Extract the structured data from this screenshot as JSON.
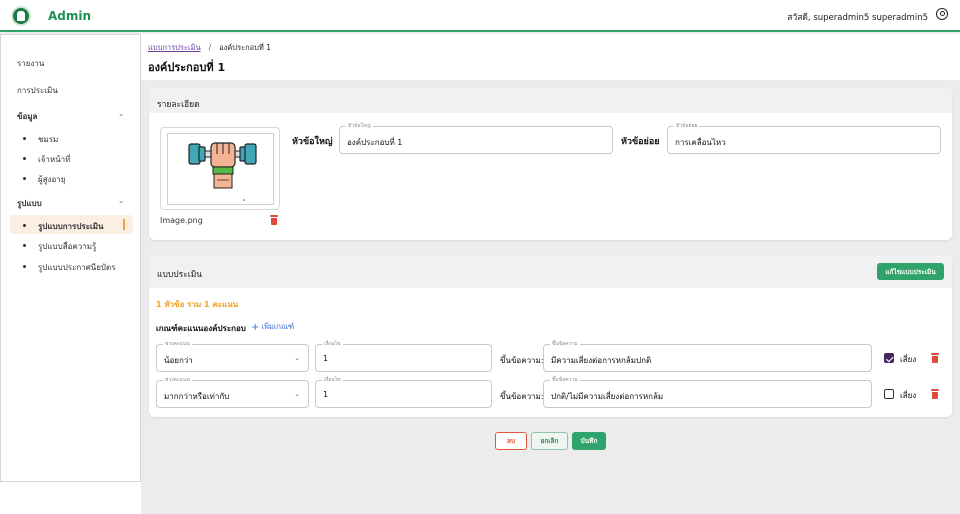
{
  "header": {
    "brand": "Admin",
    "greeting": "สวัสดี, superadmin5 superadmin5"
  },
  "sidebar": {
    "items": [
      {
        "label": "รายงาน"
      },
      {
        "label": "การประเมิน"
      }
    ],
    "sections": [
      {
        "label": "ข้อมูล",
        "children": [
          "ชมรม",
          "เจ้าหน้าที่",
          "ผู้สูงอายุ"
        ]
      },
      {
        "label": "รูปแบบ",
        "children": [
          "รูปแบบการประเมิน",
          "รูปแบบสื่อความรู้",
          "รูปแบบประกาศนียบัตร"
        ]
      }
    ],
    "active": "รูปแบบการประเมิน"
  },
  "breadcrumb": {
    "parent": "แบบการประเมิน",
    "current": "องค์ประกอบที่ 1"
  },
  "page_title": "องค์ประกอบที่ 1",
  "details": {
    "header": "รายละเอียด",
    "image_name": "Image.png",
    "main_topic_label": "หัวข้อใหญ่",
    "main_topic_floating": "หัวข้อใหญ่",
    "main_topic_value": "องค์ประกอบที่ 1",
    "sub_topic_label": "หัวข้อย่อย",
    "sub_topic_floating": "หัวข้อย่อย",
    "sub_topic_value": "การเคลื่อนไหว"
  },
  "assessment": {
    "header": "แบบประเมิน",
    "edit_button": "แก้ไขแบบประเมิน",
    "summary": "1 หัวข้อ รวม 1 คะแนน",
    "criteria_title": "เกณฑ์คะแนนองค์ประกอบ",
    "add_criteria": "เพิ่มเกณฑ์",
    "rows": [
      {
        "range_label": "ช่วงคะแนน",
        "range_value": "น้อยกว่า",
        "condition_label": "เงื่อนไข",
        "condition_value": "1",
        "show_text_label": "ขึ้นข้อความ:",
        "message_label": "ขึ้นข้อความ",
        "message_value": "มีความเสี่ยงต่อการหกล้มปกติ",
        "risk_label": "เสี่ยง",
        "risk_checked": true
      },
      {
        "range_label": "ช่วงคะแนน",
        "range_value": "มากกว่าหรือเท่ากับ",
        "condition_label": "เงื่อนไข",
        "condition_value": "1",
        "show_text_label": "ขึ้นข้อความ:",
        "message_label": "ขึ้นข้อความ",
        "message_value": "ปกติ/ไม่มีความเสี่ยงต่อการหกล้ม",
        "risk_label": "เสี่ยง",
        "risk_checked": false
      }
    ]
  },
  "actions": {
    "delete": "ลบ",
    "cancel": "ยกเลิก",
    "save": "บันทึก"
  }
}
